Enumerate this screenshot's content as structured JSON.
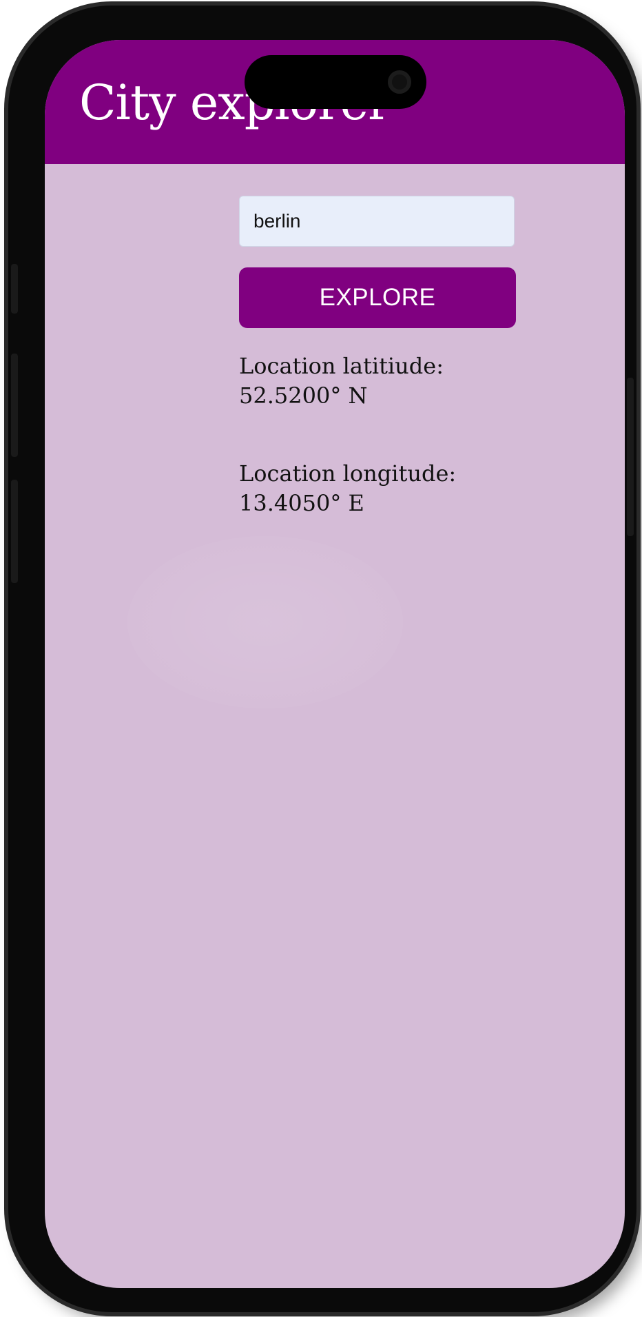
{
  "app": {
    "title": "City explorer"
  },
  "search": {
    "value": "berlin",
    "placeholder": ""
  },
  "actions": {
    "explore_label": "EXPLORE"
  },
  "location": {
    "latitude_label": "Location latitiude:",
    "latitude_value": "52.5200° N",
    "longitude_label": "Location longitude:",
    "longitude_value": "13.4050° E"
  },
  "colors": {
    "primary": "#800080",
    "background": "#d5bcd7",
    "input_background": "#e8eefa"
  }
}
